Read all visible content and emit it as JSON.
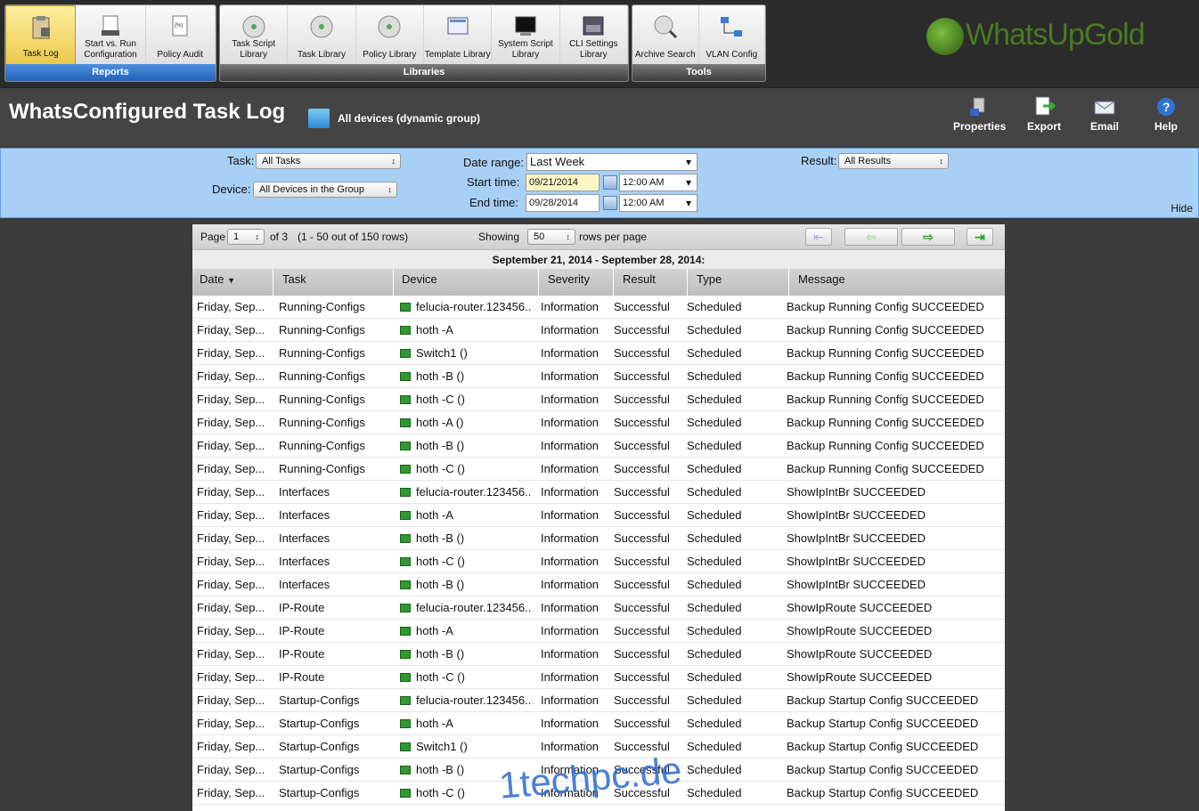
{
  "toolbar": {
    "reports": {
      "label": "Reports",
      "buttons": [
        "Task Log",
        "Start vs. Run Configuration",
        "Policy Audit"
      ]
    },
    "libraries": {
      "label": "Libraries",
      "buttons": [
        "Task Script Library",
        "Task Library",
        "Policy Library",
        "Template Library",
        "System Script Library",
        "CLI Settings Library"
      ]
    },
    "tools": {
      "label": "Tools",
      "buttons": [
        "Archive Search",
        "VLAN Config"
      ]
    }
  },
  "logo": "WhatsUpGold",
  "header": {
    "title": "WhatsConfigured Task Log",
    "group": "All devices (dynamic group)",
    "actions": [
      "Properties",
      "Export",
      "Email",
      "Help"
    ]
  },
  "filters": {
    "task_label": "Task:",
    "task_value": "All Tasks",
    "device_label": "Device:",
    "device_value": "All Devices in the Group",
    "date_range_label": "Date range:",
    "date_range_value": "Last Week",
    "start_label": "Start time:",
    "start_date": "09/21/2014",
    "start_time": "12:00 AM",
    "end_label": "End time:",
    "end_date": "09/28/2014",
    "end_time": "12:00 AM",
    "result_label": "Result:",
    "result_value": "All Results",
    "hide": "Hide"
  },
  "pager": {
    "page_label": "Page",
    "page": "1",
    "of": "of 3",
    "rows_info": "(1 - 50 out of 150 rows)",
    "showing_label": "Showing",
    "per_page": "50",
    "per_page_suffix": "rows per page"
  },
  "date_range_caption": "September 21, 2014 - September 28, 2014:",
  "columns": [
    "Date",
    "Task",
    "Device",
    "Severity",
    "Result",
    "Type",
    "Message"
  ],
  "rows": [
    [
      "Friday, Sep...",
      "Running-Configs",
      "felucia-router.123456..",
      "Information",
      "Successful",
      "Scheduled",
      "Backup Running Config SUCCEEDED"
    ],
    [
      "Friday, Sep...",
      "Running-Configs",
      "hoth -A",
      "Information",
      "Successful",
      "Scheduled",
      "Backup Running Config SUCCEEDED"
    ],
    [
      "Friday, Sep...",
      "Running-Configs",
      "Switch1 ()",
      "Information",
      "Successful",
      "Scheduled",
      "Backup Running Config SUCCEEDED"
    ],
    [
      "Friday, Sep...",
      "Running-Configs",
      "hoth -B ()",
      "Information",
      "Successful",
      "Scheduled",
      "Backup Running Config SUCCEEDED"
    ],
    [
      "Friday, Sep...",
      "Running-Configs",
      "hoth -C ()",
      "Information",
      "Successful",
      "Scheduled",
      "Backup Running Config SUCCEEDED"
    ],
    [
      "Friday, Sep...",
      "Running-Configs",
      "hoth -A ()",
      "Information",
      "Successful",
      "Scheduled",
      "Backup Running Config SUCCEEDED"
    ],
    [
      "Friday, Sep...",
      "Running-Configs",
      "hoth -B ()",
      "Information",
      "Successful",
      "Scheduled",
      "Backup Running Config SUCCEEDED"
    ],
    [
      "Friday, Sep...",
      "Running-Configs",
      "hoth -C ()",
      "Information",
      "Successful",
      "Scheduled",
      "Backup Running Config SUCCEEDED"
    ],
    [
      "Friday, Sep...",
      "Interfaces",
      "felucia-router.123456..",
      "Information",
      "Successful",
      "Scheduled",
      "ShowIpIntBr SUCCEEDED"
    ],
    [
      "Friday, Sep...",
      "Interfaces",
      "hoth -A",
      "Information",
      "Successful",
      "Scheduled",
      "ShowIpIntBr SUCCEEDED"
    ],
    [
      "Friday, Sep...",
      "Interfaces",
      "hoth -B ()",
      "Information",
      "Successful",
      "Scheduled",
      "ShowIpIntBr SUCCEEDED"
    ],
    [
      "Friday, Sep...",
      "Interfaces",
      "hoth -C ()",
      "Information",
      "Successful",
      "Scheduled",
      "ShowIpIntBr SUCCEEDED"
    ],
    [
      "Friday, Sep...",
      "Interfaces",
      "hoth -B ()",
      "Information",
      "Successful",
      "Scheduled",
      "ShowIpIntBr SUCCEEDED"
    ],
    [
      "Friday, Sep...",
      "IP-Route",
      "felucia-router.123456..",
      "Information",
      "Successful",
      "Scheduled",
      "ShowIpRoute SUCCEEDED"
    ],
    [
      "Friday, Sep...",
      "IP-Route",
      "hoth -A",
      "Information",
      "Successful",
      "Scheduled",
      "ShowIpRoute SUCCEEDED"
    ],
    [
      "Friday, Sep...",
      "IP-Route",
      "hoth -B ()",
      "Information",
      "Successful",
      "Scheduled",
      "ShowIpRoute SUCCEEDED"
    ],
    [
      "Friday, Sep...",
      "IP-Route",
      "hoth -C ()",
      "Information",
      "Successful",
      "Scheduled",
      "ShowIpRoute SUCCEEDED"
    ],
    [
      "Friday, Sep...",
      "Startup-Configs",
      "felucia-router.123456..",
      "Information",
      "Successful",
      "Scheduled",
      "Backup Startup Config SUCCEEDED"
    ],
    [
      "Friday, Sep...",
      "Startup-Configs",
      "hoth -A",
      "Information",
      "Successful",
      "Scheduled",
      "Backup Startup Config SUCCEEDED"
    ],
    [
      "Friday, Sep...",
      "Startup-Configs",
      "Switch1 ()",
      "Information",
      "Successful",
      "Scheduled",
      "Backup Startup Config SUCCEEDED"
    ],
    [
      "Friday, Sep...",
      "Startup-Configs",
      "hoth -B ()",
      "Information",
      "Successful",
      "Scheduled",
      "Backup Startup Config SUCCEEDED"
    ],
    [
      "Friday, Sep...",
      "Startup-Configs",
      "hoth -C ()",
      "Information",
      "Successful",
      "Scheduled",
      "Backup Startup Config SUCCEEDED"
    ]
  ],
  "watermark": "1techpc.de",
  "colors": {
    "accent": "#a8cff5",
    "active_tab": "#e9c84a",
    "device_icon": "#2f9a2f"
  }
}
